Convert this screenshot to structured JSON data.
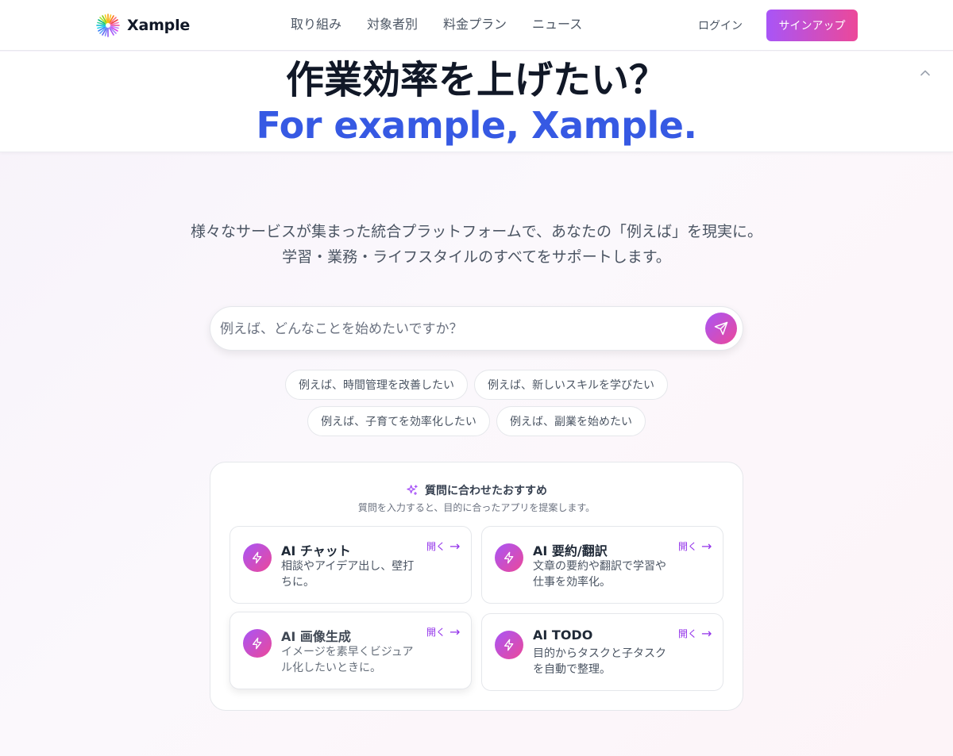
{
  "header": {
    "brand": "Xample",
    "nav": [
      "取り組み",
      "対象者別",
      "料金プラン",
      "ニュース"
    ],
    "login": "ログイン",
    "signup": "サインアップ"
  },
  "hero": {
    "title": "作業効率を上げたい？",
    "subtitle": "For example, Xample."
  },
  "description": {
    "line1": "様々なサービスが集まった統合プラットフォームで、あなたの「例えば」を現実に。",
    "line2": "学習・業務・ライフスタイルのすべてをサポートします。"
  },
  "search": {
    "placeholder": "例えば、どんなことを始めたいですか？"
  },
  "suggestions": [
    "例えば、時間管理を改善したい",
    "例えば、新しいスキルを学びたい",
    "例えば、子育てを効率化したい",
    "例えば、副業を始めたい"
  ],
  "recommend": {
    "title": "質問に合わせたおすすめ",
    "subtitle": "質問を入力すると、目的に合ったアプリを提案します。",
    "open_label": "開く",
    "cards": [
      {
        "title": "AI チャット",
        "desc": "相談やアイデア出し、壁打ちに。"
      },
      {
        "title": "AI 要約/翻訳",
        "desc": "文章の要約や翻訳で学習や仕事を効率化。"
      },
      {
        "title": "AI 画像生成",
        "desc": "イメージを素早くビジュアル化したいときに。"
      },
      {
        "title": "AI TODO",
        "desc": "目的からタスクと子タスクを自動で整理。"
      }
    ]
  },
  "colors": {
    "accent_from": "#a855f7",
    "accent_to": "#ec4899",
    "hero_blue": "#3659e3"
  }
}
